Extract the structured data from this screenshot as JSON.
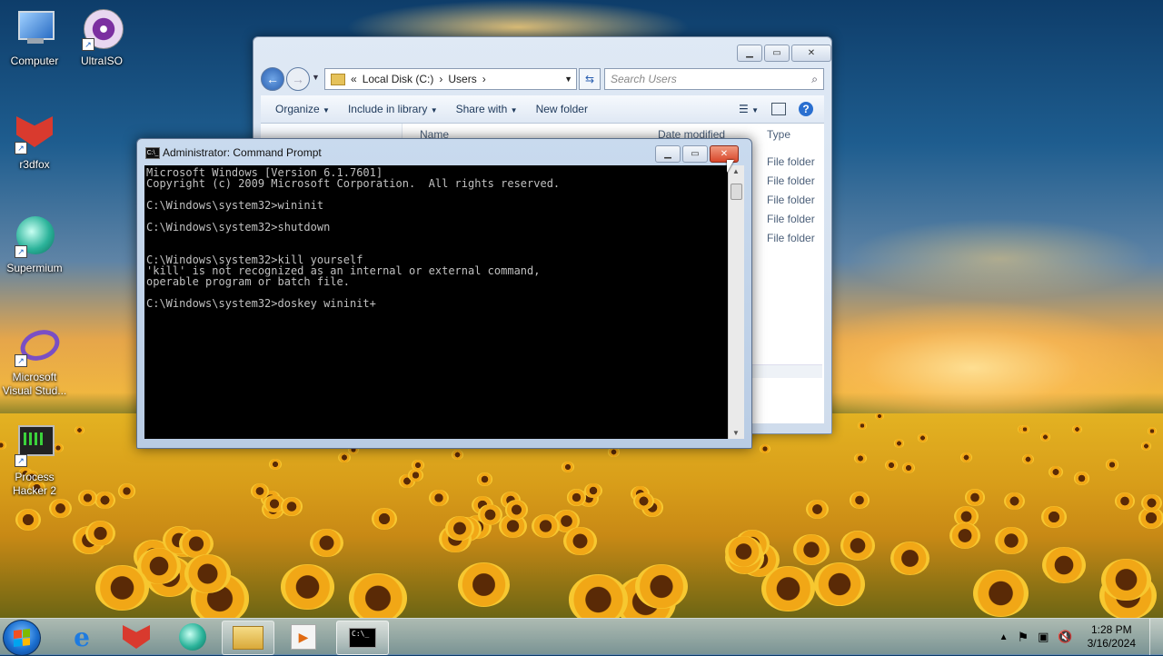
{
  "desktop": {
    "icons": [
      {
        "label": "Computer"
      },
      {
        "label": "UltraISO"
      },
      {
        "label": "r3dfox"
      },
      {
        "label": "Supermium"
      },
      {
        "label": "Microsoft Visual Stud..."
      },
      {
        "label": "Process Hacker 2"
      }
    ]
  },
  "explorer": {
    "breadcrumb": [
      "«",
      "Local Disk (C:)",
      "›",
      "Users",
      "›"
    ],
    "search_placeholder": "Search Users",
    "toolbar": {
      "organize": "Organize",
      "include_in_library": "Include in library",
      "share_with": "Share with",
      "new_folder": "New folder"
    },
    "columns": {
      "name": "Name",
      "date_modified": "Date modified",
      "type": "Type"
    },
    "rows": [
      {
        "type": "File folder"
      },
      {
        "type": "File folder"
      },
      {
        "type": "File folder"
      },
      {
        "type": "File folder"
      },
      {
        "type": "File folder"
      }
    ]
  },
  "cmd": {
    "title": "Administrator: Command Prompt",
    "icon_text": "C:\\_",
    "lines": [
      "Microsoft Windows [Version 6.1.7601]",
      "Copyright (c) 2009 Microsoft Corporation.  All rights reserved.",
      "",
      "C:\\Windows\\system32>wininit",
      "",
      "C:\\Windows\\system32>shutdown",
      "",
      "",
      "C:\\Windows\\system32>kill yourself",
      "'kill' is not recognized as an internal or external command,",
      "operable program or batch file.",
      "",
      "C:\\Windows\\system32>doskey wininit+"
    ]
  },
  "taskbar": {
    "time": "1:28 PM",
    "date": "3/16/2024",
    "cmd_button_text": "C:\\_"
  },
  "colors": {
    "console_bg": "#000000",
    "console_fg": "#c0c0c0",
    "close_button": "#d9472b"
  }
}
